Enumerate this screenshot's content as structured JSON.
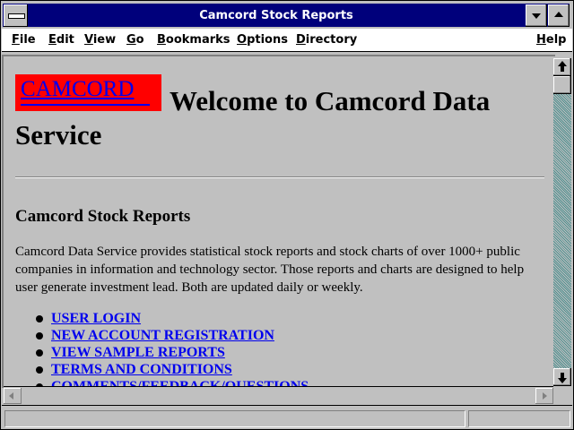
{
  "window": {
    "title": "Camcord Stock Reports"
  },
  "menubar": {
    "items": [
      {
        "label": "File"
      },
      {
        "label": "Edit"
      },
      {
        "label": "View"
      },
      {
        "label": "Go"
      },
      {
        "label": "Bookmarks"
      },
      {
        "label": "Options"
      },
      {
        "label": "Directory"
      },
      {
        "label": "Help"
      }
    ]
  },
  "page": {
    "logo_text": "CAMCORD",
    "heading_line1": "Welcome to Camcord Data",
    "heading_line2": "Service",
    "section_title": "Camcord Stock Reports",
    "paragraph": "Camcord Data Service provides statistical stock reports and stock charts of over 1000+ public companies in information and technology sector. Those reports and charts are designed to help user generate investment lead. Both are updated daily or weekly.",
    "links": [
      {
        "label": "USER LOGIN"
      },
      {
        "label": "NEW ACCOUNT REGISTRATION"
      },
      {
        "label": "VIEW SAMPLE REPORTS"
      },
      {
        "label": "TERMS AND CONDITIONS"
      },
      {
        "label": "COMMENTS/FEEDBACK/QUESTIONS"
      }
    ]
  },
  "colors": {
    "titlebar": "#00007b",
    "link": "#0000ee",
    "logo_bg": "#ff0000",
    "chrome": "#c0c0c0"
  },
  "icons": {
    "system_menu": "system-menu-icon",
    "minimize": "minimize-icon",
    "maximize": "maximize-icon",
    "scroll_up": "arrow-up-icon",
    "scroll_down": "arrow-down-icon",
    "scroll_left": "arrow-left-icon",
    "scroll_right": "arrow-right-icon"
  }
}
